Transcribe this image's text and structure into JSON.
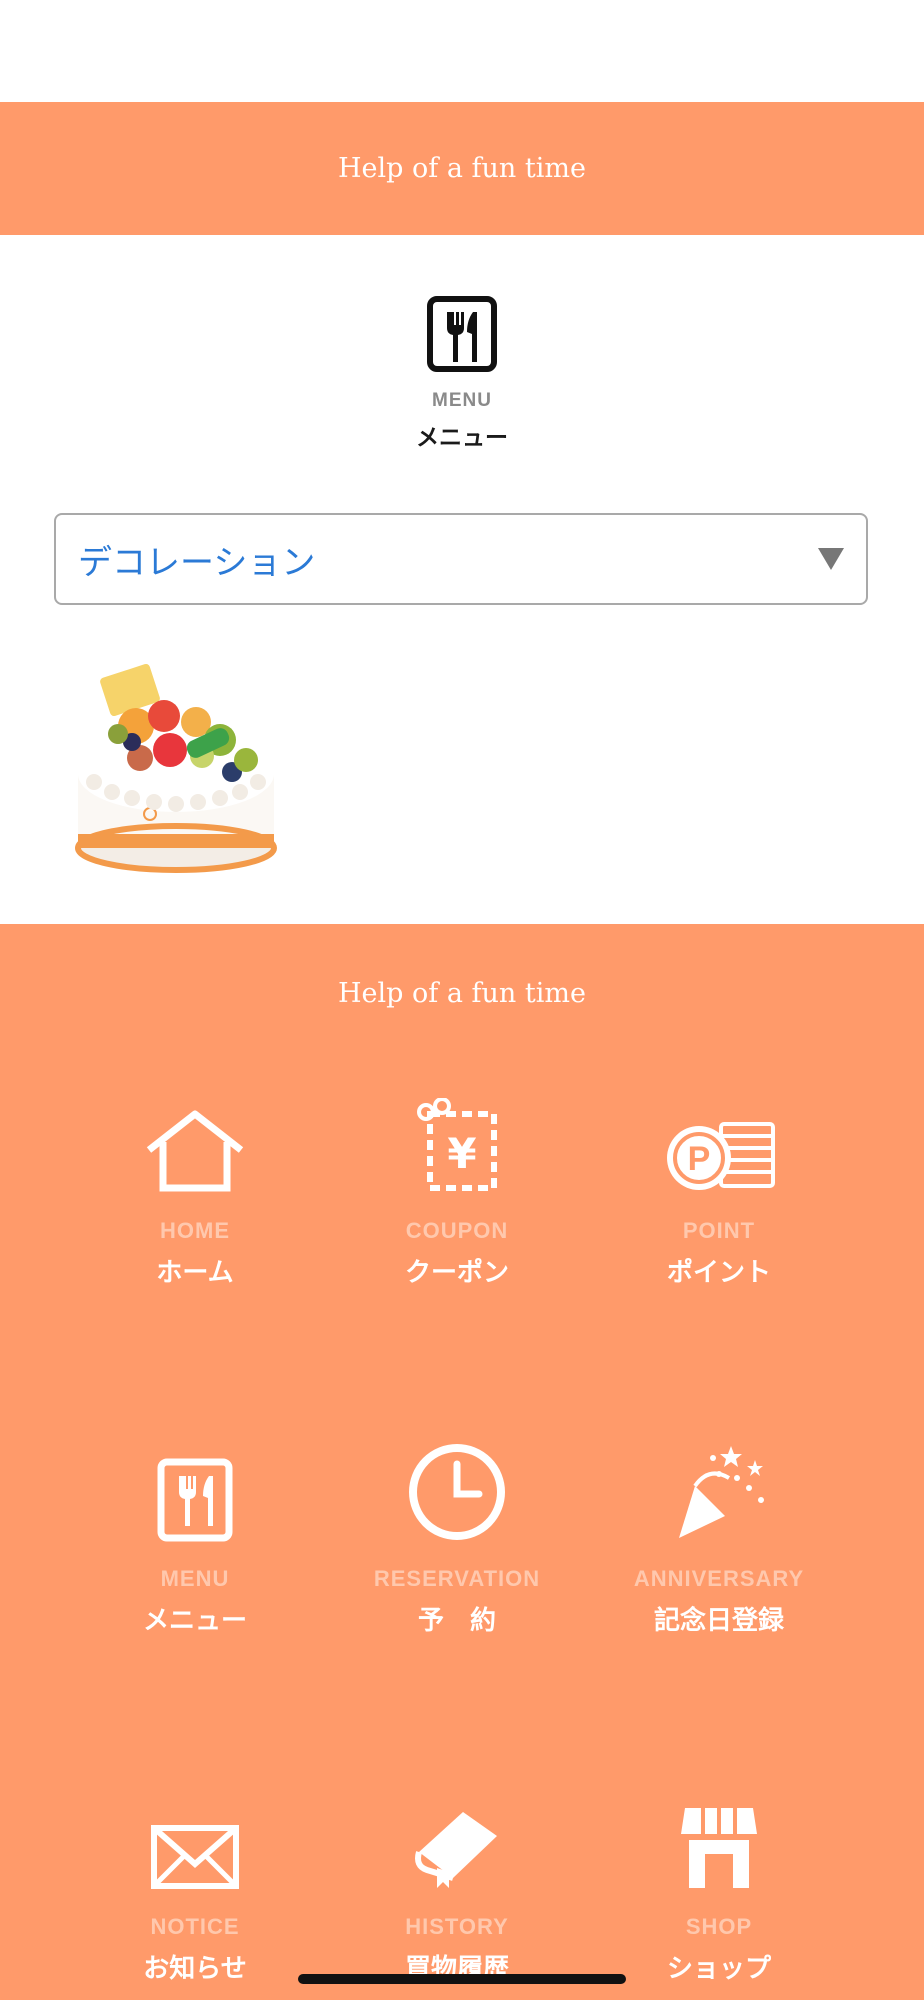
{
  "header": {
    "tagline": "Help of a fun time"
  },
  "menu_section": {
    "icon": "fork-knife-icon",
    "label_en": "MENU",
    "label_jp": "メニュー"
  },
  "category_select": {
    "value": "デコレーション"
  },
  "product": {
    "image": "decoration-cake-image"
  },
  "footer": {
    "tagline": "Help of a fun time",
    "nav": [
      {
        "icon": "home-icon",
        "en": "HOME",
        "jp": "ホーム"
      },
      {
        "icon": "coupon-icon",
        "en": "COUPON",
        "jp": "クーポン"
      },
      {
        "icon": "point-icon",
        "en": "POINT",
        "jp": "ポイント"
      },
      {
        "icon": "menu-icon",
        "en": "MENU",
        "jp": "メニュー"
      },
      {
        "icon": "clock-icon",
        "en": "RESERVATION",
        "jp": "予　約"
      },
      {
        "icon": "party-popper-icon",
        "en": "ANNIVERSARY",
        "jp": "記念日登録"
      },
      {
        "icon": "mail-icon",
        "en": "NOTICE",
        "jp": "お知らせ"
      },
      {
        "icon": "book-icon",
        "en": "HISTORY",
        "jp": "買物履歴"
      },
      {
        "icon": "shop-icon",
        "en": "SHOP",
        "jp": "ショップ"
      }
    ]
  },
  "colors": {
    "accent": "#ff9a6a",
    "select_text": "#2b7ad6"
  }
}
